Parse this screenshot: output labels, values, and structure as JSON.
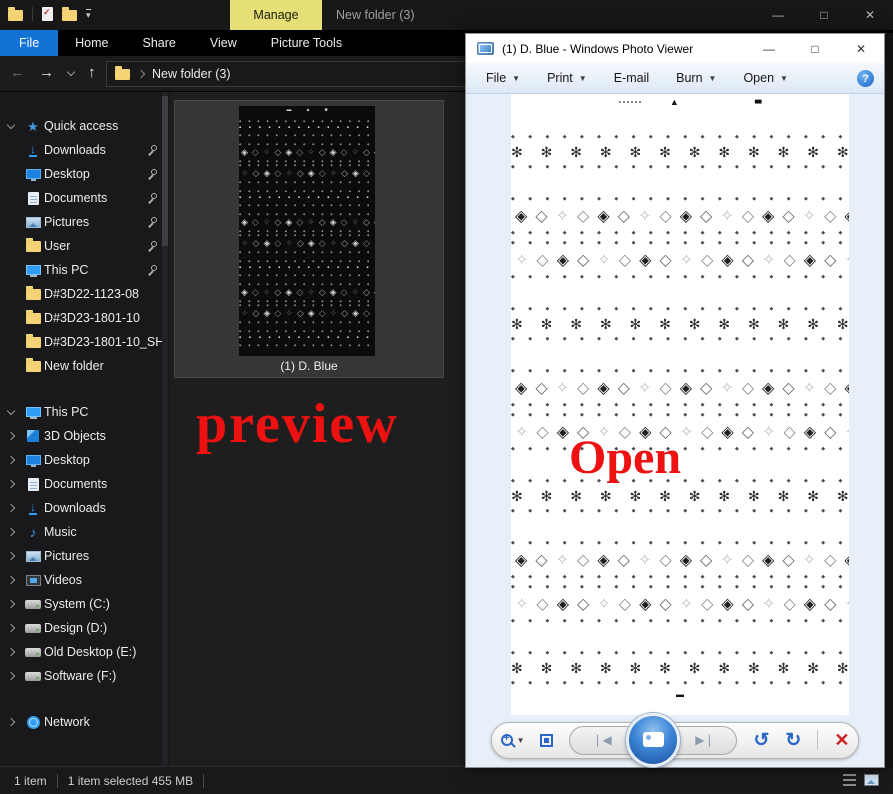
{
  "explorer": {
    "contextual_tab": "Manage",
    "window_title": "New folder (3)",
    "window_controls": {
      "minimize": "—",
      "maximize": "□",
      "close": "✕"
    },
    "ribbon_tabs": [
      {
        "label": "File"
      },
      {
        "label": "Home"
      },
      {
        "label": "Share"
      },
      {
        "label": "View"
      },
      {
        "label": "Picture Tools"
      }
    ],
    "nav": {
      "back": "←",
      "forward": "→",
      "up": "↑",
      "address": "New folder (3)"
    },
    "sidebar": {
      "quick_access": {
        "label": "Quick access",
        "items": [
          {
            "label": "Downloads",
            "icon": "download",
            "pinned": true
          },
          {
            "label": "Desktop",
            "icon": "monitor",
            "pinned": true
          },
          {
            "label": "Documents",
            "icon": "doc",
            "pinned": true
          },
          {
            "label": "Pictures",
            "icon": "picture",
            "pinned": true
          },
          {
            "label": "User",
            "icon": "folder",
            "pinned": true
          },
          {
            "label": "This PC",
            "icon": "pc",
            "pinned": true
          },
          {
            "label": "D#3D22-1123-08",
            "icon": "folder",
            "pinned": false
          },
          {
            "label": "D#3D23-1801-10",
            "icon": "folder",
            "pinned": false
          },
          {
            "label": "D#3D23-1801-10_SH",
            "icon": "folder",
            "pinned": false
          },
          {
            "label": "New folder",
            "icon": "folder",
            "pinned": false
          }
        ]
      },
      "this_pc": {
        "label": "This PC",
        "items": [
          {
            "label": "3D Objects",
            "icon": "cube"
          },
          {
            "label": "Desktop",
            "icon": "monitor"
          },
          {
            "label": "Documents",
            "icon": "doc"
          },
          {
            "label": "Downloads",
            "icon": "download"
          },
          {
            "label": "Music",
            "icon": "music"
          },
          {
            "label": "Pictures",
            "icon": "picture"
          },
          {
            "label": "Videos",
            "icon": "video"
          },
          {
            "label": "System (C:)",
            "icon": "drive"
          },
          {
            "label": "Design (D:)",
            "icon": "drive"
          },
          {
            "label": "Old Desktop  (E:)",
            "icon": "drive"
          },
          {
            "label": "Software (F:)",
            "icon": "drive"
          }
        ]
      },
      "network": {
        "label": "Network"
      }
    },
    "file_item": {
      "label": "(1) D. Blue"
    },
    "status": {
      "items": "1 item",
      "selection": "1 item selected  455 MB"
    }
  },
  "viewer": {
    "title": "(1) D. Blue - Windows Photo Viewer",
    "window_controls": {
      "minimize": "—",
      "maximize": "□",
      "close": "✕"
    },
    "menu": [
      {
        "label": "File",
        "dropdown": true
      },
      {
        "label": "Print",
        "dropdown": true
      },
      {
        "label": "E-mail",
        "dropdown": false
      },
      {
        "label": "Burn",
        "dropdown": true
      },
      {
        "label": "Open",
        "dropdown": true
      }
    ],
    "help_label": "?",
    "toolbar": {
      "rotate_ccw": "↺",
      "rotate_cw": "↻",
      "delete": "✕",
      "prev": "❘◀",
      "next": "▶❘"
    },
    "image_markers": {
      "triangle": "▲",
      "squares": "■■",
      "bottom_bar": "▬"
    }
  },
  "annotations": {
    "preview": "preview",
    "open": "Open"
  },
  "pattern": {
    "bands": [
      "flower",
      "diamondA",
      "diamondB",
      "flower",
      "diamondA",
      "diamondB",
      "flower",
      "diamondA",
      "diamondB",
      "flower"
    ],
    "viewer_theme": {
      "dot": "◆",
      "flower": "✻",
      "solid": "◈",
      "outline": "◇",
      "light": "✧",
      "dot_count": 44,
      "flower_count": 24,
      "diamond_count": 18
    },
    "thumb_theme": {
      "dot": "◆",
      "flower": "▪",
      "solid": "◈",
      "outline": "◇",
      "light": "✧",
      "dot_count": 44,
      "flower_count": 28,
      "diamond_count": 16
    }
  }
}
